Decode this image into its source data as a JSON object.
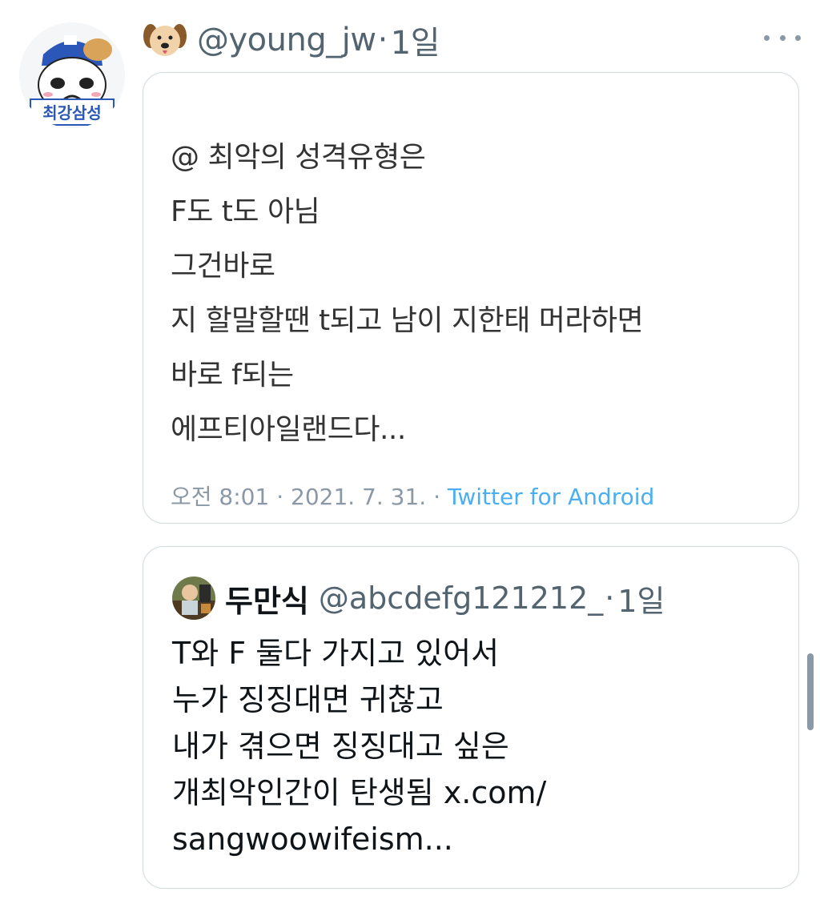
{
  "tweet": {
    "avatar_text": "최강삼성",
    "author_emoji": "dog-face",
    "author_handle": "@young_jw",
    "separator": "·",
    "time_ago": "1일",
    "more_icon": "ellipsis-icon"
  },
  "screenshot": {
    "lines": [
      "@ 최악의 성격유형은",
      "F도 t도 아님",
      "그건바로",
      "지 할말할땐 t되고 남이 지한태 머라하면",
      "바로 f되는",
      "에프티아일랜드다..."
    ],
    "meta_prefix": "오전 8:01 · 2021. 7. 31. · ",
    "client": "Twitter for Android"
  },
  "quote": {
    "name": "두만식",
    "handle": "@abcdefg121212_",
    "separator": "·",
    "time_ago": "1일",
    "lines": [
      "T와 F 둘다 가지고 있어서",
      "누가 징징대면 귀찮고",
      "내가 겪으면 징징대고 싶은",
      "개최악인간이 탄생됨 x.com/",
      "sangwoowifeism..."
    ]
  },
  "colors": {
    "border": "#cfd9de",
    "muted": "#536471",
    "text": "#0f1419",
    "link": "#1d9bf0"
  }
}
